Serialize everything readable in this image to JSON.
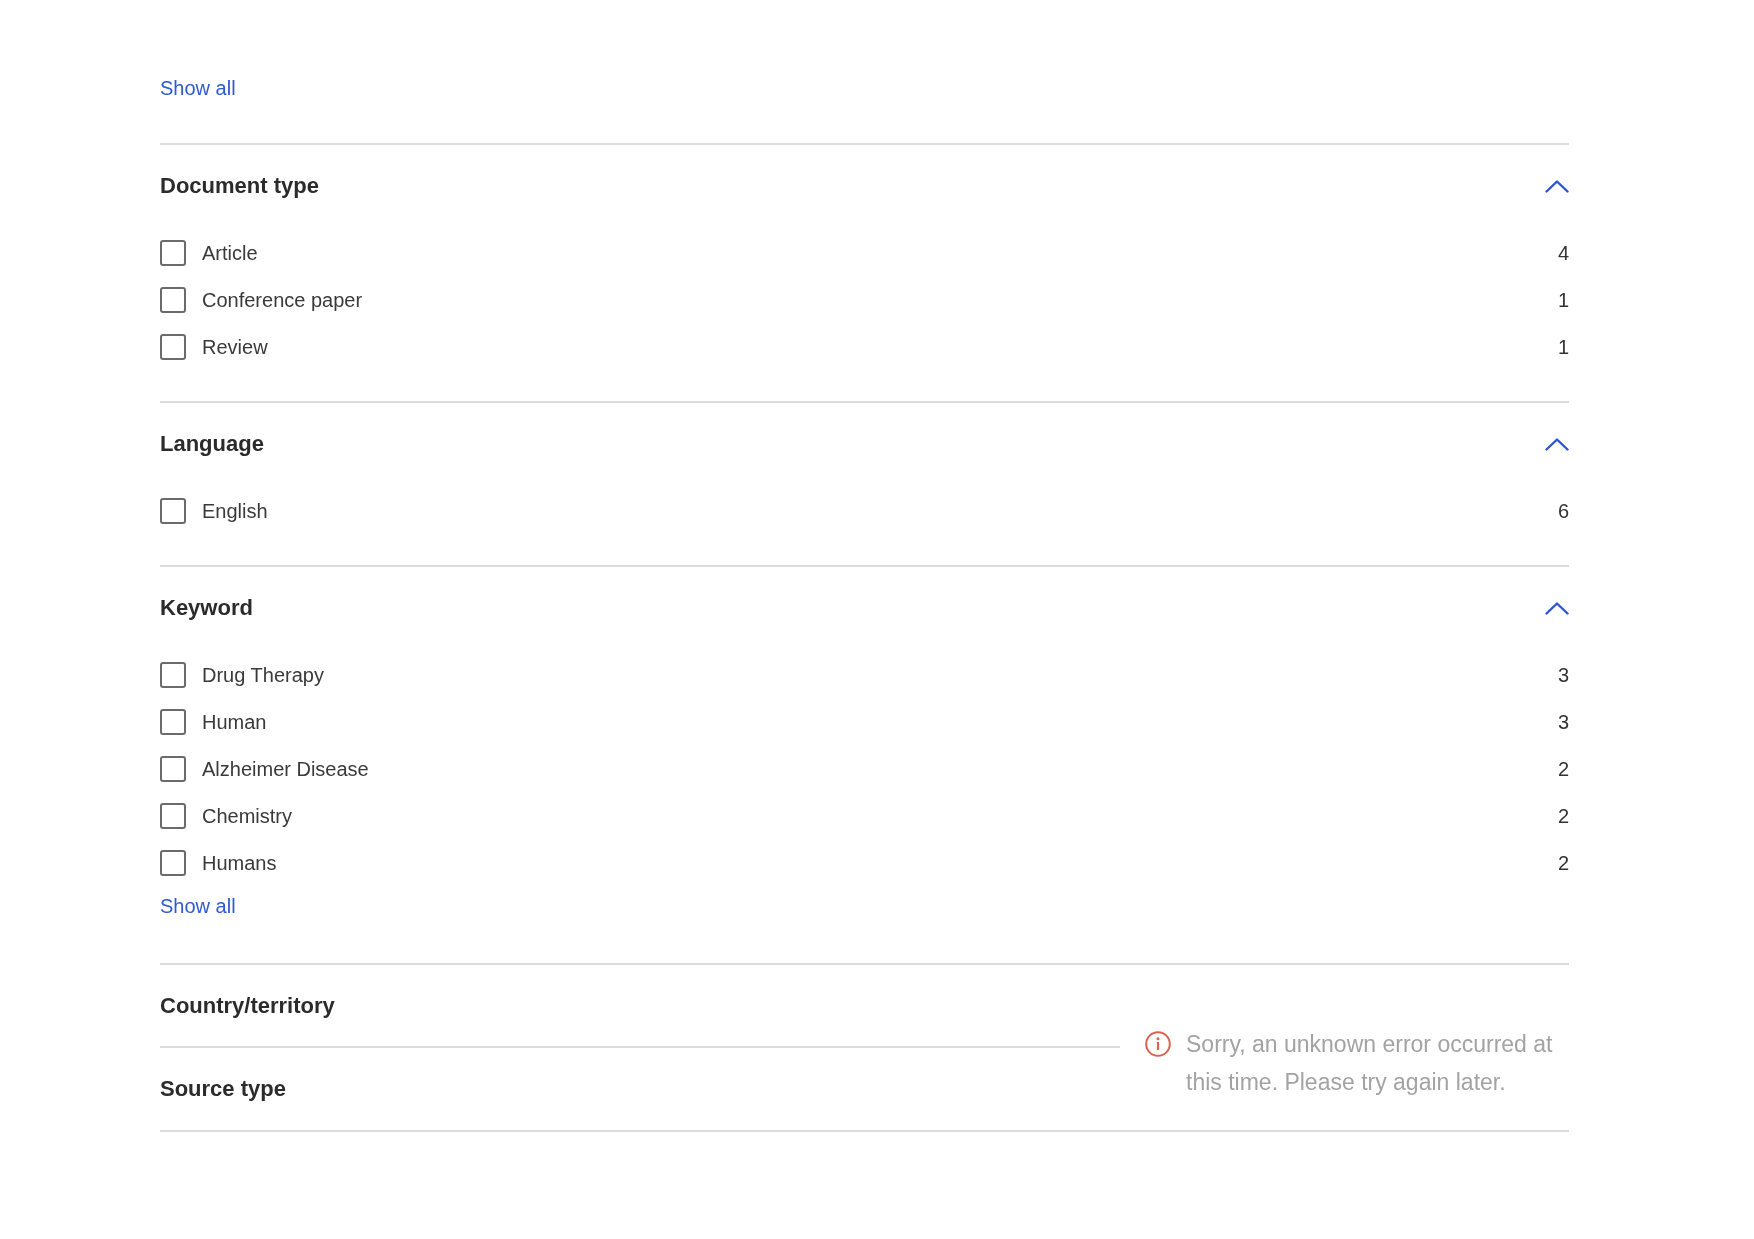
{
  "top_link": "Show all",
  "filters": [
    {
      "title": "Document type",
      "expanded": true,
      "options": [
        {
          "label": "Article",
          "count": "4",
          "checked": false
        },
        {
          "label": "Conference paper",
          "count": "1",
          "checked": false
        },
        {
          "label": "Review",
          "count": "1",
          "checked": false
        }
      ]
    },
    {
      "title": "Language",
      "expanded": true,
      "options": [
        {
          "label": "English",
          "count": "6",
          "checked": false
        }
      ]
    },
    {
      "title": "Keyword",
      "expanded": true,
      "options": [
        {
          "label": "Drug Therapy",
          "count": "3",
          "checked": false
        },
        {
          "label": "Human",
          "count": "3",
          "checked": false
        },
        {
          "label": "Alzheimer Disease",
          "count": "2",
          "checked": false
        },
        {
          "label": "Chemistry",
          "count": "2",
          "checked": false
        },
        {
          "label": "Humans",
          "count": "2",
          "checked": false
        }
      ],
      "show_all": "Show all"
    }
  ],
  "unavailable_filters": [
    "Country/territory",
    "Source type"
  ],
  "error_message": "Sorry, an unknown error occurred at this time. Please try again later."
}
